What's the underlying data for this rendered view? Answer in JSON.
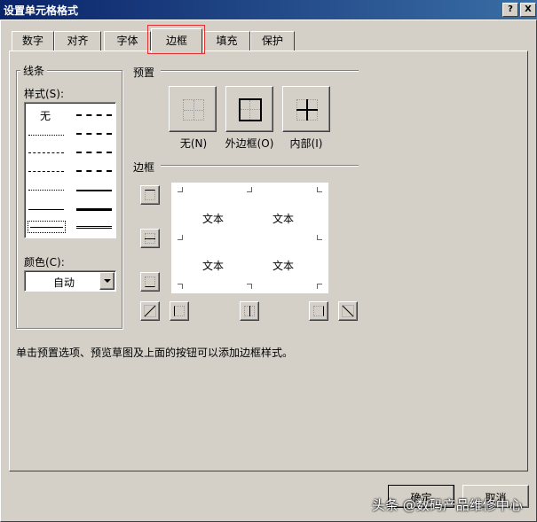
{
  "dialog": {
    "title": "设置单元格格式",
    "help_label": "?",
    "close_label": "X"
  },
  "tabs": [
    {
      "label": "数字"
    },
    {
      "label": "对齐"
    },
    {
      "label": "字体"
    },
    {
      "label": "边框",
      "active": true
    },
    {
      "label": "填充"
    },
    {
      "label": "保护"
    }
  ],
  "line_group": {
    "title": "线条",
    "style_label": "样式(S):",
    "none_label": "无",
    "color_label": "颜色(C):",
    "color_value": "自动"
  },
  "presets": {
    "title": "预置",
    "none_label": "无(N)",
    "outline_label": "外边框(O)",
    "inside_label": "内部(I)"
  },
  "border": {
    "title": "边框",
    "preview_text": [
      "文本",
      "文本",
      "文本",
      "文本"
    ]
  },
  "hint": "单击预置选项、预览草图及上面的按钮可以添加边框样式。",
  "buttons": {
    "ok_label": "确定",
    "cancel_label": "取消"
  },
  "watermark": "头条 @数码产品维修中心",
  "colors": {
    "dialog_bg": "#d4d0c8",
    "title_bar_start": "#0a246a",
    "title_bar_end": "#3a6ea5",
    "highlight": "#e03030"
  }
}
